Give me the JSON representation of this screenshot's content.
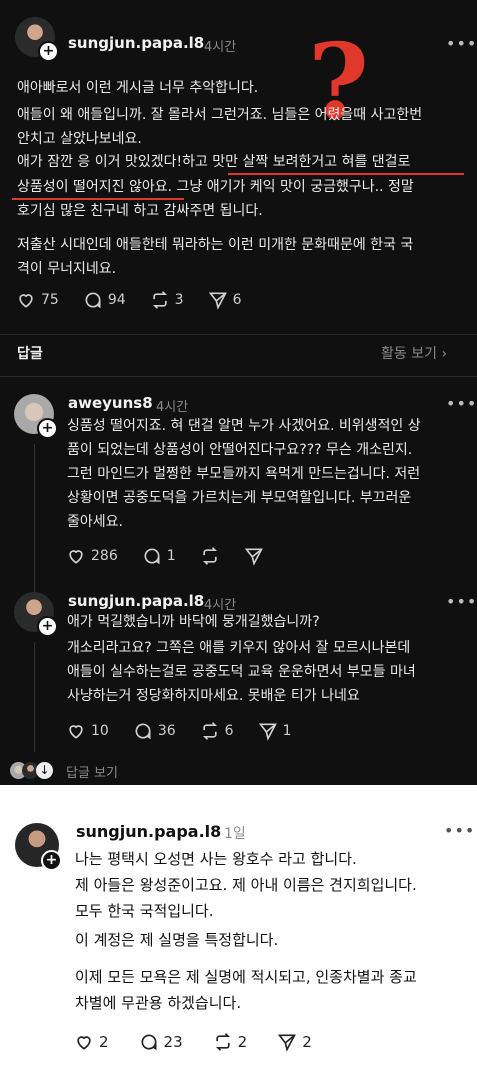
{
  "post": {
    "username": "sungjun.papa.l8",
    "time": "4시간",
    "lines": [
      "애아빠로서 이런 게시글 너무 추악합니다.",
      "애들이 왜 애들입니까. 잘 몰라서 그런거죠. 님들은 어렸을때 사고한번",
      "안치고 살았나보네요.",
      "애가 잠깐 응 이거 맛있겠다!하고 맛만 살짝 보려한거고 혀를 댄걸로",
      "상품성이 떨어지진 않아요. 그냥 애기가 케익 맛이 궁금했구나.. 정말",
      "호기심 많은 친구네 하고 감싸주면 됩니다.",
      "저출산 시대인데 애들한테 뭐라하는 이런 미개한 문화때문에 한국 국",
      "격이 무너지네요."
    ],
    "likes": "75",
    "comments": "94",
    "reposts": "3",
    "shares": "6",
    "annotation": "?"
  },
  "replies_header": {
    "label": "답글",
    "activity": "활동 보기"
  },
  "reply1": {
    "username": "aweyuns8",
    "time": "4시간",
    "lines": [
      "싱품성 떨어지죠. 혀 댄걸 알면 누가 사겠어요. 비위생적인 상",
      "품이 되었는데 상품성이 안떨어진다구요??? 무슨 개소린지.",
      "그런 마인드가 멀쩡한 부모들까지 욕먹게 만드는겁니다. 저런",
      "상황이면 공중도덕을 가르치는게 부모역할입니다. 부끄러운",
      "줄아세요."
    ],
    "likes": "286",
    "comments": "1"
  },
  "reply2": {
    "username": "sungjun.papa.l8",
    "time": "4시간",
    "lines": [
      "애가 먹길했습니까 바닥에 뭉개길했습니까?",
      "개소리라고요? 그쪽은 애를 키우지 않아서 잘 모르시나본데",
      "애들이 실수하는걸로 공중도덕 교육 운운하면서 부모들 마녀",
      "사냥하는거 정당화하지마세요. 못배운 티가 나네요"
    ],
    "likes": "10",
    "comments": "36",
    "reposts": "6",
    "shares": "1"
  },
  "more_replies": "답글 보기",
  "post2": {
    "username": "sungjun.papa.l8",
    "time": "1일",
    "lines": [
      "나는 평택시 오성면 사는 왕호수 라고 합니다.",
      "제 아들은 왕성준이고요. 제 아내 이름은 견지희입니다.",
      "모두 한국 국적입니다.",
      "이 계정은 제 실명을 특정합니다.",
      "이제 모든 모욕은 제 실명에 적시되고, 인종차별과 종교",
      "차별에 무관용 하겠습니다."
    ],
    "likes": "2",
    "comments": "23",
    "reposts": "2",
    "shares": "2"
  }
}
